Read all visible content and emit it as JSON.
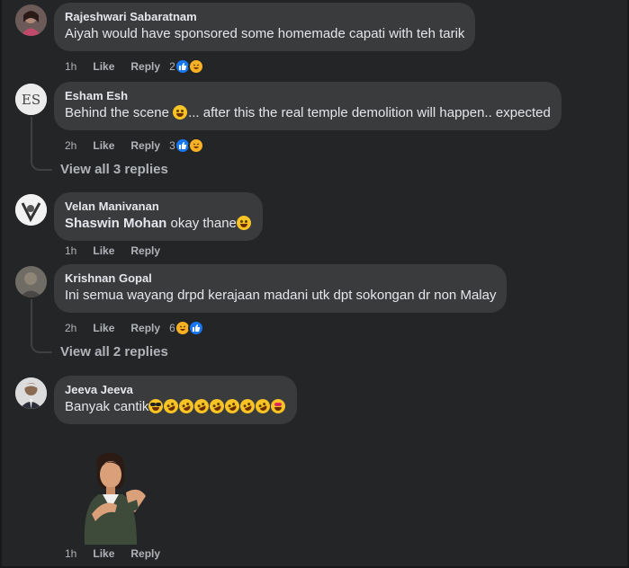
{
  "colors": {
    "background": "#242526",
    "bubble": "#3a3b3c",
    "text": "#e4e6eb",
    "muted": "#b0b3b8",
    "like": "#1877f2",
    "haha": "#f7b125"
  },
  "comments": [
    {
      "author": "Rajeshwari Sabaratnam",
      "text": "Aiyah would have sponsored some homemade capati with teh tarik",
      "time": "1h",
      "like": "Like",
      "reply": "Reply",
      "reactions": {
        "count": "2",
        "icons": [
          "like-icon",
          "haha-icon"
        ]
      }
    },
    {
      "author": "Esham Esh",
      "text_before": "Behind the scene ",
      "text_after": "... after this the real temple demolition will happen.. expected",
      "time": "2h",
      "like": "Like",
      "reply": "Reply",
      "reactions": {
        "count": "3",
        "icons": [
          "like-icon",
          "haha-icon"
        ]
      },
      "view_replies": "View all 3 replies"
    },
    {
      "author": "Velan Manivanan",
      "mention": "Shaswin Mohan",
      "text": " okay thane",
      "time": "1h",
      "like": "Like",
      "reply": "Reply"
    },
    {
      "author": "Krishnan Gopal",
      "text": "Ini semua wayang drpd kerajaan madani utk dpt sokongan dr non Malay",
      "time": "2h",
      "like": "Like",
      "reply": "Reply",
      "reactions": {
        "count": "6",
        "icons": [
          "haha-icon",
          "like-icon"
        ]
      },
      "view_replies": "View all 2 replies"
    },
    {
      "author": "Jeeva Jeeva",
      "text": "Banyak cantik",
      "time": "1h",
      "like": "Like",
      "reply": "Reply"
    },
    {
      "sticker": "avatar-sticker",
      "time": "1h",
      "like": "Like",
      "reply": "Reply"
    }
  ]
}
